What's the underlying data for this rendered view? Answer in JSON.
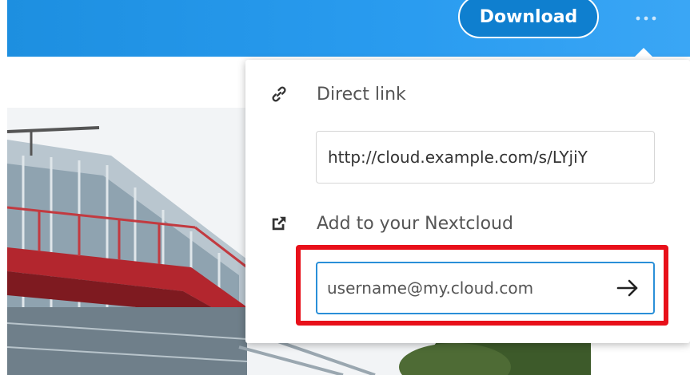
{
  "header": {
    "download_label": "Download",
    "more_icon": "ellipsis-icon",
    "background_color": "#1d8fe0"
  },
  "menu": {
    "direct_link": {
      "label": "Direct link",
      "icon": "link-icon",
      "value": "http://cloud.example.com/s/LYjiY"
    },
    "add_to_nextcloud": {
      "label": "Add to your Nextcloud",
      "icon": "external-link-icon",
      "placeholder": "username@my.cloud.com",
      "submit_icon": "arrow-right-icon"
    }
  },
  "highlight_color": "#e8101a"
}
